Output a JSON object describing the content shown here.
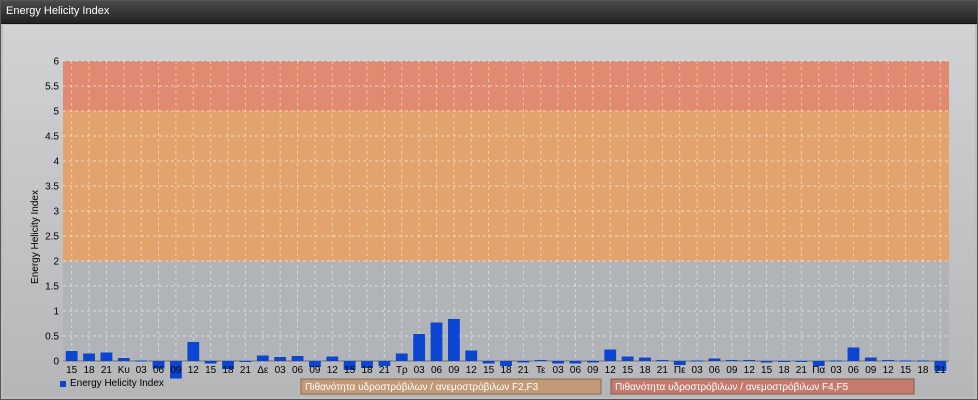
{
  "window": {
    "title": "Energy Helicity Index"
  },
  "colors": {
    "bar": "#0a46d2",
    "band_low": "#b0b4b8",
    "band_mid": "#e2a46c",
    "band_high": "#e08a72",
    "legend_box_mid": "#c29a78",
    "legend_box_high": "#c47a6c"
  },
  "chart_data": {
    "type": "bar",
    "ylabel": "Energy Helicity Index",
    "ylim": [
      -0.25,
      6
    ],
    "yticks": [
      "0",
      "0.5",
      "1",
      "1.5",
      "2",
      "2.5",
      "3",
      "3.5",
      "4",
      "4.5",
      "5",
      "5.5",
      "6"
    ],
    "bands": [
      {
        "from": 0,
        "to": 2,
        "label": ""
      },
      {
        "from": 2,
        "to": 5,
        "label": "Πιθανότητα υδροστρόβιλων / ανεμοστρόβιλων F2,F3"
      },
      {
        "from": 5,
        "to": 6,
        "label": "Πιθανότητα υδροστρόβιλων / ανεμοστρόβιλων F4,F5"
      }
    ],
    "categories": [
      "15",
      "18",
      "21",
      "Κυ",
      "03",
      "06",
      "09",
      "12",
      "15",
      "18",
      "21",
      "Δε",
      "03",
      "06",
      "09",
      "12",
      "15",
      "18",
      "21",
      "Τρ",
      "03",
      "06",
      "09",
      "12",
      "15",
      "18",
      "21",
      "Τε",
      "03",
      "06",
      "09",
      "12",
      "15",
      "18",
      "21",
      "Πε",
      "03",
      "06",
      "09",
      "12",
      "15",
      "18",
      "21",
      "Πα",
      "03",
      "06",
      "09",
      "12",
      "15",
      "18",
      "21"
    ],
    "values": [
      0.2,
      0.15,
      0.17,
      0.06,
      0.01,
      -0.15,
      -0.35,
      0.38,
      -0.05,
      -0.16,
      -0.02,
      0.11,
      0.08,
      0.1,
      -0.12,
      0.09,
      -0.18,
      -0.14,
      -0.1,
      0.15,
      0.54,
      0.77,
      0.84,
      0.21,
      -0.05,
      -0.1,
      -0.03,
      0.02,
      -0.05,
      -0.05,
      -0.03,
      0.23,
      0.09,
      0.07,
      0.02,
      -0.08,
      0.01,
      0.05,
      0.02,
      0.02,
      -0.03,
      -0.02,
      -0.02,
      -0.1,
      0.01,
      0.27,
      0.07,
      0.02,
      0.01,
      0.01,
      -0.2
    ],
    "series": [
      {
        "name": "Energy Helicity Index"
      }
    ],
    "legend": "bottom-left",
    "grid": true
  }
}
